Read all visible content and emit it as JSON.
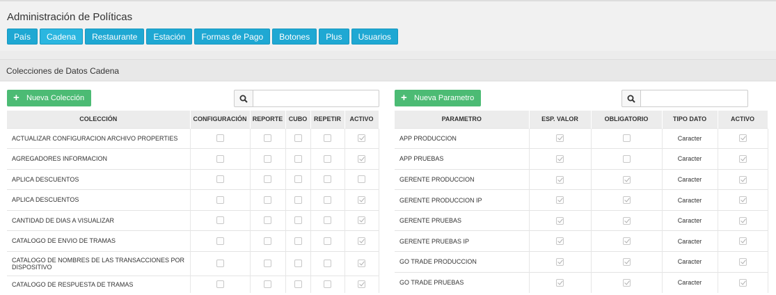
{
  "header": {
    "title": "Administración de Políticas",
    "tabs": [
      "País",
      "Cadena",
      "Restaurante",
      "Estación",
      "Formas de Pago",
      "Botones",
      "Plus",
      "Usuarios"
    ],
    "active_tab": "Cadena"
  },
  "section": {
    "label": "Colecciones de Datos Cadena"
  },
  "left": {
    "new_button": "Nueva Colección",
    "search_value": "",
    "columns": [
      "COLECCIÓN",
      "CONFIGURACIÓN",
      "REPORTE",
      "CUBO",
      "REPETIR",
      "ACTIVO"
    ],
    "rows": [
      {
        "name": "ACTUALIZAR CONFIGURACION ARCHIVO PROPERTIES",
        "configuracion": false,
        "reporte": false,
        "cubo": false,
        "repetir": false,
        "activo": true
      },
      {
        "name": "AGREGADORES INFORMACION",
        "configuracion": false,
        "reporte": false,
        "cubo": false,
        "repetir": false,
        "activo": true
      },
      {
        "name": "APLICA DESCUENTOS",
        "configuracion": false,
        "reporte": false,
        "cubo": false,
        "repetir": false,
        "activo": false
      },
      {
        "name": "APLICA DESCUENTOS",
        "configuracion": false,
        "reporte": false,
        "cubo": false,
        "repetir": false,
        "activo": true
      },
      {
        "name": "CANTIDAD DE DIAS A VISUALIZAR",
        "configuracion": false,
        "reporte": false,
        "cubo": false,
        "repetir": false,
        "activo": true
      },
      {
        "name": "CATALOGO DE ENVIO DE TRAMAS",
        "configuracion": false,
        "reporte": false,
        "cubo": false,
        "repetir": false,
        "activo": true
      },
      {
        "name": "CATALOGO DE NOMBRES DE LAS TRANSACCIONES POR DISPOSITIVO",
        "configuracion": false,
        "reporte": false,
        "cubo": false,
        "repetir": false,
        "activo": true
      },
      {
        "name": "CATALOGO DE RESPUESTA DE TRAMAS",
        "configuracion": false,
        "reporte": false,
        "cubo": false,
        "repetir": false,
        "activo": true
      }
    ]
  },
  "right": {
    "new_button": "Nueva Parametro",
    "search_value": "",
    "columns": [
      "PARAMETRO",
      "ESP. VALOR",
      "OBLIGATORIO",
      "TIPO DATO",
      "ACTIVO"
    ],
    "rows": [
      {
        "name": "APP PRODUCCION",
        "esp_valor": true,
        "obligatorio": false,
        "tipo": "Caracter",
        "activo": true
      },
      {
        "name": "APP PRUEBAS",
        "esp_valor": true,
        "obligatorio": false,
        "tipo": "Caracter",
        "activo": true
      },
      {
        "name": "GERENTE PRODUCCION",
        "esp_valor": true,
        "obligatorio": true,
        "tipo": "Caracter",
        "activo": true
      },
      {
        "name": "GERENTE PRODUCCION IP",
        "esp_valor": true,
        "obligatorio": true,
        "tipo": "Caracter",
        "activo": true
      },
      {
        "name": "GERENTE PRUEBAS",
        "esp_valor": true,
        "obligatorio": true,
        "tipo": "Caracter",
        "activo": true
      },
      {
        "name": "GERENTE PRUEBAS IP",
        "esp_valor": true,
        "obligatorio": true,
        "tipo": "Caracter",
        "activo": true
      },
      {
        "name": "GO TRADE PRODUCCION",
        "esp_valor": true,
        "obligatorio": true,
        "tipo": "Caracter",
        "activo": true
      },
      {
        "name": "GO TRADE PRUEBAS",
        "esp_valor": true,
        "obligatorio": true,
        "tipo": "Caracter",
        "activo": true
      }
    ]
  },
  "colors": {
    "tab": "#1fa8d3",
    "green_button": "#4cbb74"
  }
}
